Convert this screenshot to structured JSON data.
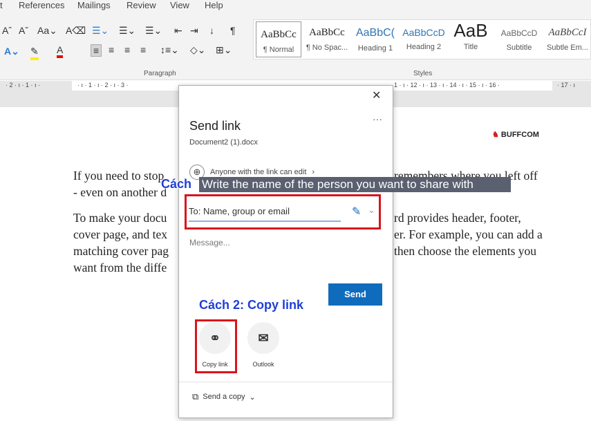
{
  "menu": [
    "References",
    "Mailings",
    "Review",
    "View",
    "Help"
  ],
  "ribbon": {
    "paragraph_label": "Paragraph",
    "styles_label": "Styles",
    "font_case": "Aa",
    "styles": [
      {
        "sample": "AaBbCc",
        "label": "¶ Normal"
      },
      {
        "sample": "AaBbCc",
        "label": "¶ No Spac..."
      },
      {
        "sample": "AaBbC(",
        "label": "Heading 1"
      },
      {
        "sample": "AaBbCcD",
        "label": "Heading 2"
      },
      {
        "sample": "AaB",
        "label": "Title"
      },
      {
        "sample": "AaBbCcD",
        "label": "Subtitle"
      },
      {
        "sample": "AaBbCcI",
        "label": "Subtle Em..."
      }
    ]
  },
  "ruler": {
    "left": "· 2 · ı · 1 · ı ·",
    "mid": "· ı · 1 · ı · 2 · ı · 3 ·",
    "right": "1 · ı · 12 · ı · 13 · ı · 14 · ı · 15 · ı · 16 ·",
    "far": "· 17 · ı"
  },
  "document": {
    "left": [
      "If you need to stop",
      "- even on another d",
      "To make your docu",
      "cover page, and tex",
      "matching cover pag",
      "want from the diffe"
    ],
    "right": [
      "remembers where you left off",
      "rd provides header, footer,",
      "er. For example, you can add a",
      "then choose the elements you"
    ]
  },
  "logo": "BUFFCOM",
  "dialog": {
    "title": "Send link",
    "filename": "Document2 (1).docx",
    "more": "···",
    "close": "✕",
    "permission": "Anyone with the link can edit",
    "to_placeholder": "To: Name, group or email",
    "message_placeholder": "Message...",
    "send": "Send",
    "copy_link": "Copy link",
    "outlook": "Outlook",
    "send_copy": "Send a copy"
  },
  "annotations": {
    "step1_prefix": "Cách",
    "step1": "Write the name of the person you want to share with",
    "step2": "Cách 2: Copy link"
  },
  "colors": {
    "accent": "#0f6cbd",
    "annotation_red": "#d9141b",
    "annotation_blue": "#1f3fd6"
  }
}
